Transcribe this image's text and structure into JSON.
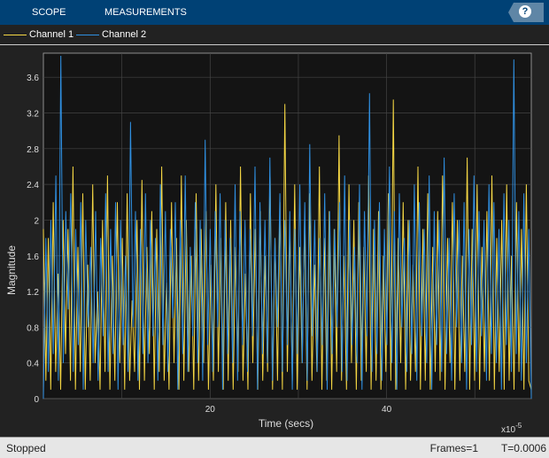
{
  "toolbar": {
    "tabs": [
      "SCOPE",
      "MEASUREMENTS"
    ],
    "help": "?"
  },
  "legend": {
    "items": [
      {
        "label": "Channel 1",
        "color": "#f5d744"
      },
      {
        "label": "Channel 2",
        "color": "#2f8fe0"
      }
    ]
  },
  "status": {
    "state": "Stopped",
    "frames": "Frames=1",
    "time": "T=0.0006"
  },
  "chart_data": {
    "type": "line",
    "xlabel": "Time (secs)",
    "ylabel": "Magnitude",
    "x_exponent": "x10",
    "x_exponent_power": "-5",
    "xlim": [
      1.1,
      56.4
    ],
    "ylim": [
      0,
      3.87
    ],
    "xticks": [
      {
        "v": 20,
        "label": "20"
      },
      {
        "v": 40,
        "label": "40"
      }
    ],
    "xgrid": [
      10,
      20,
      30,
      40,
      50
    ],
    "yticks": [
      {
        "v": 0,
        "label": "0"
      },
      {
        "v": 0.4,
        "label": "0.4"
      },
      {
        "v": 0.8,
        "label": "0.8"
      },
      {
        "v": 1.2,
        "label": "1.2"
      },
      {
        "v": 1.6,
        "label": "1.6"
      },
      {
        "v": 2,
        "label": "2"
      },
      {
        "v": 2.4,
        "label": "2.4"
      },
      {
        "v": 2.8,
        "label": "2.8"
      },
      {
        "v": 3.2,
        "label": "3.2"
      },
      {
        "v": 3.6,
        "label": "3.6"
      }
    ],
    "grid": true,
    "x_start": 1.1,
    "x_step": 0.25,
    "series": [
      {
        "name": "Channel 1",
        "color": "#f5d744",
        "values": [
          1.9,
          0.2,
          1.8,
          0.1,
          2.2,
          0.3,
          1.4,
          0.1,
          2.0,
          0.5,
          1.9,
          0.2,
          2.6,
          0.1,
          1.7,
          0.3,
          2.3,
          0.1,
          1.5,
          0.2,
          2.4,
          0.4,
          1.2,
          0.1,
          2.0,
          0.3,
          2.5,
          0.1,
          1.6,
          0.2,
          2.2,
          0.4,
          1.8,
          0.1,
          2.3,
          0.2,
          1.1,
          0.3,
          2.0,
          0.1,
          2.45,
          0.2,
          1.7,
          0.5,
          2.1,
          0.1,
          1.9,
          0.3,
          2.6,
          0.2,
          1.3,
          0.1,
          2.2,
          0.4,
          1.8,
          0.1,
          2.5,
          0.2,
          2.0,
          0.3,
          1.6,
          0.1,
          2.3,
          0.2,
          1.9,
          0.4,
          2.1,
          0.1,
          1.5,
          0.2,
          2.4,
          0.3,
          1.8,
          0.1,
          2.2,
          0.2,
          2.0,
          0.1,
          1.7,
          0.3,
          2.6,
          0.2,
          1.4,
          0.1,
          2.3,
          0.4,
          1.9,
          0.1,
          2.1,
          0.2,
          1.6,
          0.3,
          2.5,
          0.1,
          1.8,
          0.2,
          2.2,
          0.1,
          3.3,
          0.3,
          1.9,
          0.2,
          2.4,
          0.1,
          1.7,
          0.4,
          2.0,
          0.1,
          2.3,
          0.2,
          1.5,
          0.3,
          2.6,
          0.1,
          1.8,
          0.2,
          2.1,
          0.1,
          1.9,
          0.3,
          2.95,
          0.2,
          1.6,
          0.1,
          2.4,
          0.4,
          2.0,
          0.1,
          2.2,
          0.2,
          1.7,
          0.3,
          2.5,
          0.1,
          1.9,
          0.2,
          2.1,
          0.1,
          1.6,
          0.3,
          2.3,
          0.2,
          3.35,
          0.1,
          1.8,
          0.4,
          2.2,
          0.1,
          2.0,
          0.2,
          1.5,
          0.3,
          2.6,
          0.1,
          1.9,
          0.2,
          2.3,
          0.1,
          1.7,
          0.3,
          2.1,
          0.2,
          2.5,
          0.1,
          1.8,
          0.4,
          2.2,
          0.1,
          2.0,
          0.2,
          1.6,
          0.3,
          2.7,
          0.1,
          1.9,
          0.2,
          2.4,
          0.1,
          1.7,
          0.3,
          2.1,
          0.2,
          2.5,
          0.1,
          1.8,
          0.3,
          2.0,
          0.1,
          2.4,
          0.2,
          1.6,
          0.1,
          2.2,
          0.3,
          1.9,
          0.1,
          2.4,
          0.2,
          0.1
        ]
      },
      {
        "name": "Channel 2",
        "color": "#2f8fe0",
        "values": [
          0.0,
          1.8,
          0.3,
          2.0,
          0.5,
          2.5,
          0.2,
          3.84,
          0.4,
          2.1,
          1.0,
          2.3,
          0.3,
          1.9,
          0.6,
          2.2,
          0.1,
          2.0,
          0.8,
          1.7,
          0.4,
          2.1,
          0.2,
          1.8,
          0.7,
          2.3,
          0.3,
          1.9,
          0.5,
          2.2,
          0.1,
          2.0,
          0.6,
          1.6,
          0.3,
          3.1,
          0.8,
          2.1,
          0.2,
          1.9,
          0.5,
          2.3,
          0.4,
          2.0,
          0.7,
          1.8,
          0.2,
          2.4,
          0.6,
          2.1,
          0.3,
          1.9,
          0.9,
          2.2,
          0.1,
          2.0,
          0.5,
          2.5,
          0.3,
          1.7,
          0.7,
          2.2,
          0.4,
          2.0,
          0.2,
          2.9,
          0.6,
          1.9,
          0.3,
          2.1,
          0.8,
          2.3,
          0.1,
          2.0,
          0.5,
          1.8,
          0.4,
          2.4,
          0.2,
          2.1,
          0.6,
          2.0,
          0.3,
          1.9,
          0.7,
          2.6,
          0.1,
          2.2,
          0.5,
          2.0,
          0.4,
          2.7,
          0.2,
          1.8,
          0.8,
          2.3,
          0.3,
          2.0,
          0.6,
          2.1,
          0.1,
          1.9,
          0.5,
          2.4,
          0.4,
          2.2,
          0.2,
          2.85,
          0.7,
          2.0,
          0.3,
          1.8,
          0.6,
          2.3,
          0.1,
          2.1,
          0.5,
          1.9,
          0.8,
          2.2,
          0.3,
          2.5,
          0.2,
          2.0,
          0.6,
          1.7,
          0.4,
          2.4,
          0.1,
          2.1,
          0.7,
          3.42,
          0.3,
          2.0,
          0.5,
          2.2,
          0.2,
          1.9,
          0.6,
          2.6,
          0.4,
          2.1,
          0.1,
          2.3,
          0.8,
          1.8,
          0.3,
          2.0,
          0.5,
          2.4,
          0.2,
          2.2,
          0.7,
          1.9,
          0.4,
          2.5,
          0.1,
          2.1,
          0.6,
          2.0,
          0.3,
          2.7,
          0.5,
          1.8,
          0.2,
          2.3,
          0.8,
          2.0,
          0.4,
          2.2,
          0.1,
          1.9,
          0.6,
          2.5,
          0.3,
          2.1,
          0.7,
          2.0,
          0.2,
          2.4,
          0.5,
          2.2,
          0.4,
          1.9,
          0.1,
          2.3,
          0.6,
          2.0,
          0.3,
          3.8,
          0.5,
          2.1,
          0.2,
          2.3,
          0.4,
          1.9,
          0.0
        ]
      }
    ]
  }
}
